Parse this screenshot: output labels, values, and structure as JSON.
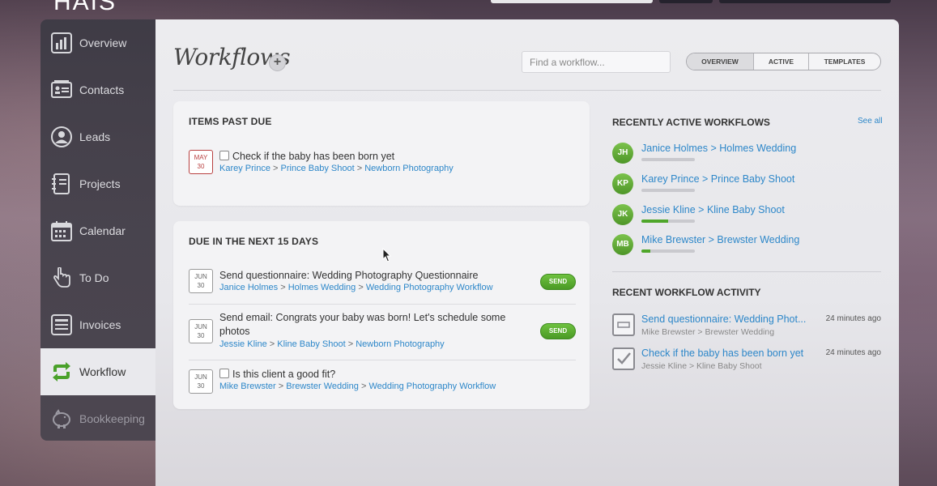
{
  "app": {
    "logo_text": "HAIS"
  },
  "sidebar": {
    "items": [
      {
        "label": "Overview"
      },
      {
        "label": "Contacts"
      },
      {
        "label": "Leads"
      },
      {
        "label": "Projects"
      },
      {
        "label": "Calendar"
      },
      {
        "label": "To Do"
      },
      {
        "label": "Invoices"
      },
      {
        "label": "Workflow"
      },
      {
        "label": "Bookkeeping"
      }
    ],
    "active": "Workflow"
  },
  "header": {
    "title": "Workflows",
    "add_label": "+",
    "search_placeholder": "Find a workflow...",
    "tabs": [
      "OVERVIEW",
      "ACTIVE",
      "TEMPLATES"
    ]
  },
  "past_due": {
    "heading": "ITEMS PAST DUE",
    "items": [
      {
        "month": "MAY",
        "day": "30",
        "title": "Check if the baby has been born yet",
        "person": "Karey Prince",
        "project": "Prince Baby Shoot",
        "workflow": "Newborn Photography"
      }
    ]
  },
  "upcoming": {
    "heading": "DUE IN THE NEXT 15 DAYS",
    "send_label": "SEND",
    "items": [
      {
        "month": "JUN",
        "day": "30",
        "title": "Send questionnaire: Wedding Photography Questionnaire",
        "person": "Janice Holmes",
        "project": "Holmes Wedding",
        "workflow": "Wedding Photography Workflow"
      },
      {
        "month": "JUN",
        "day": "30",
        "title": "Send email: Congrats your baby was born! Let's schedule some",
        "title2": "photos",
        "person": "Jessie Kline",
        "project": "Kline Baby Shoot",
        "workflow": "Newborn Photography"
      },
      {
        "month": "JUN",
        "day": "30",
        "title": "Is this client a good fit?",
        "person": "Mike Brewster",
        "project": "Brewster Wedding",
        "workflow": "Wedding Photography Workflow"
      }
    ]
  },
  "recent_workflows": {
    "heading": "RECENTLY ACTIVE WORKFLOWS",
    "see_all": "See all",
    "items": [
      {
        "initials": "JH",
        "label": "Janice Holmes > Holmes Wedding",
        "progress": 0
      },
      {
        "initials": "KP",
        "label": "Karey Prince > Prince Baby Shoot",
        "progress": 0
      },
      {
        "initials": "JK",
        "label": "Jessie Kline > Kline Baby Shoot",
        "progress": 0.5
      },
      {
        "initials": "MB",
        "label": "Mike Brewster > Brewster Wedding",
        "progress": 0.17
      }
    ]
  },
  "recent_activity": {
    "heading": "RECENT WORKFLOW ACTIVITY",
    "items": [
      {
        "title": "Send questionnaire: Wedding Phot...",
        "sub": "Mike Brewster > Brewster Wedding",
        "time": "24 minutes ago",
        "icon": "questionnaire-icon"
      },
      {
        "title": "Check if the baby has been born yet",
        "sub": "Jessie Kline > Kline Baby Shoot",
        "time": "24 minutes ago",
        "icon": "checked-box-icon"
      }
    ]
  },
  "sep": ">"
}
